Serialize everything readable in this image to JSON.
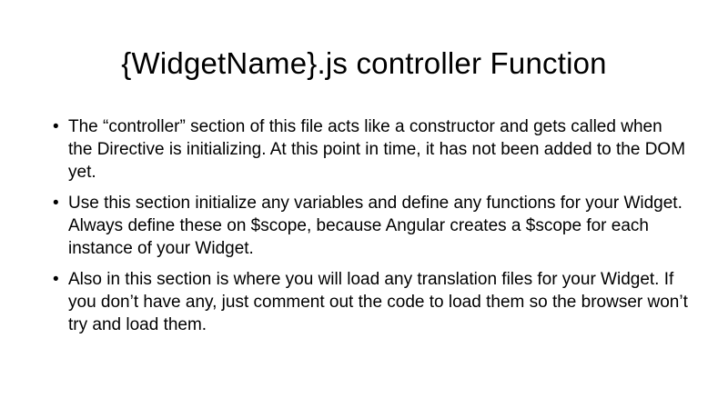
{
  "slide": {
    "title": "{WidgetName}.js controller Function",
    "bullet_marker": "•",
    "bullets": [
      {
        "text": "The “controller” section of this file acts like a constructor and gets called when the Directive is initializing. At this point in time, it has not been added to the DOM yet."
      },
      {
        "text": "Use this section initialize any variables and define any functions for your Widget. Always define these on $scope, because Angular creates a $scope for each instance of your Widget."
      },
      {
        "text": "Also in this section is where you will load any translation files for your Widget. If you don’t have any, just comment out the code to load them so the browser won’t try and load them."
      }
    ]
  }
}
